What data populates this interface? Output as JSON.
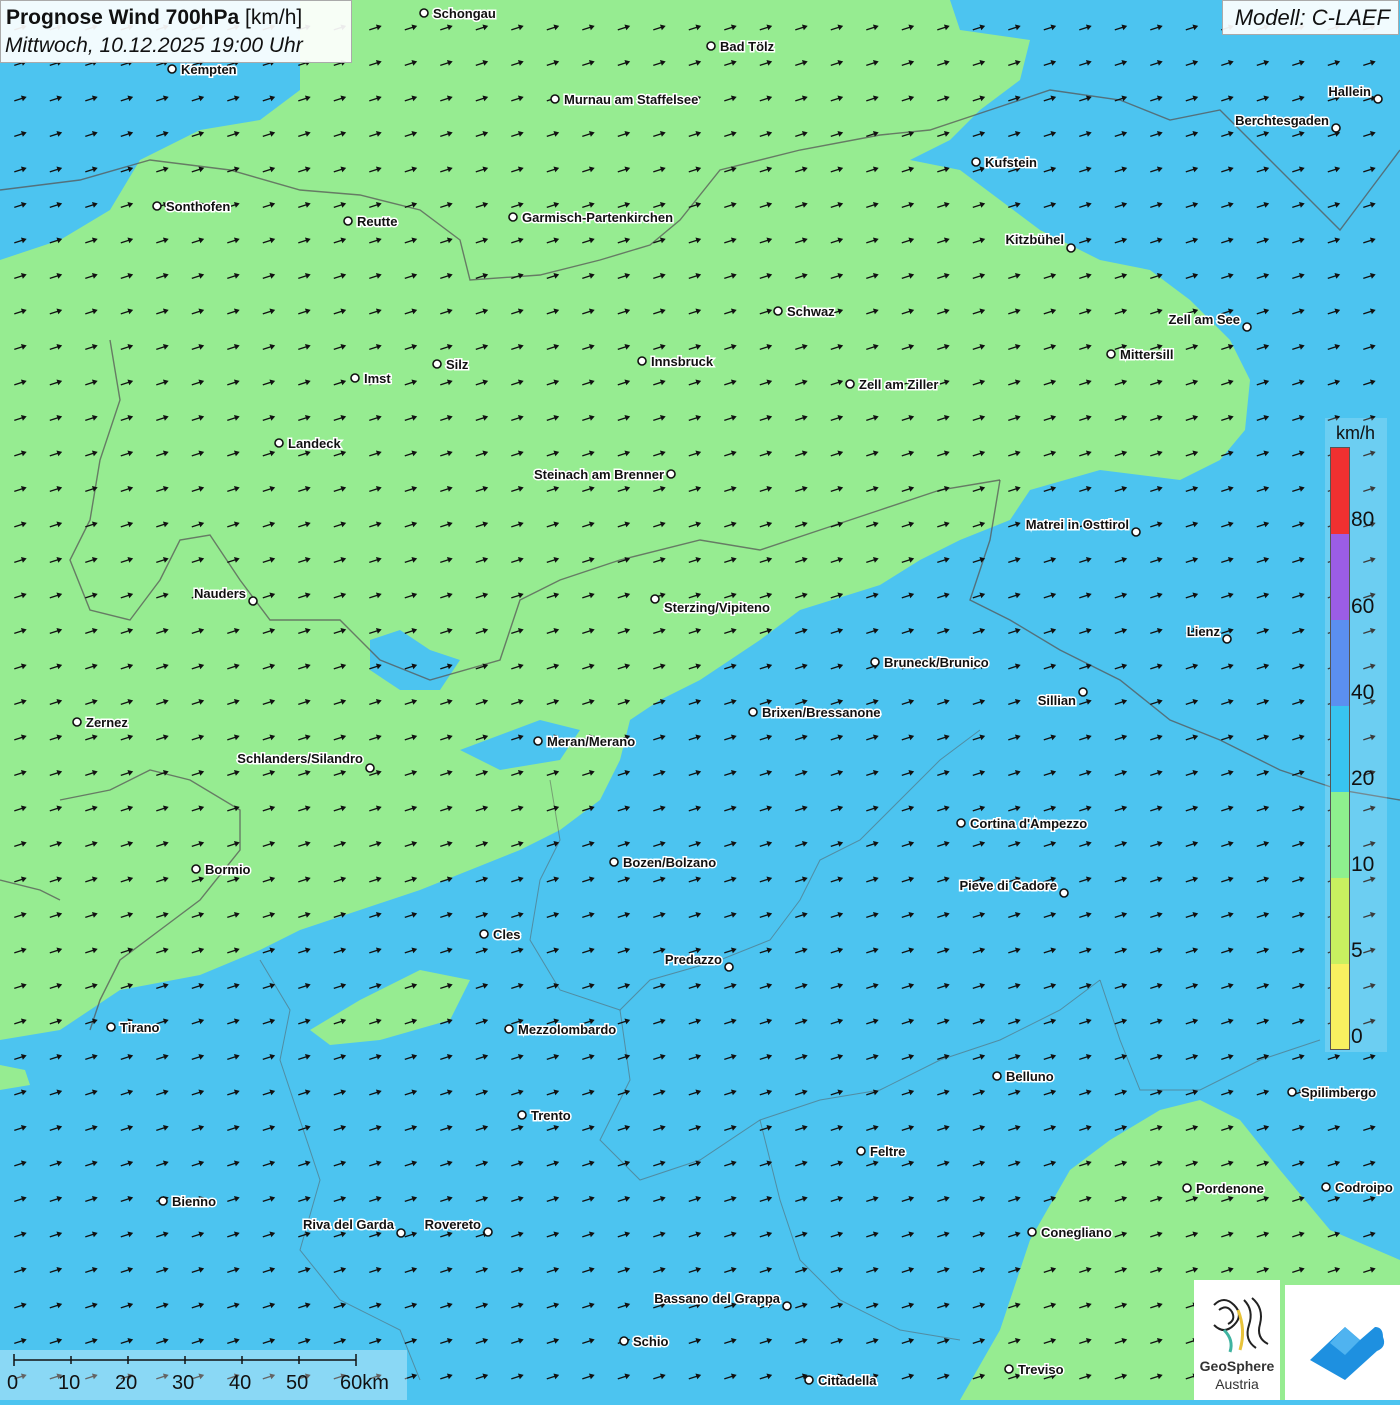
{
  "header": {
    "title_bold": "Prognose Wind 700hPa",
    "title_unit": "[km/h]",
    "datetime": "Mittwoch, 10.12.2025 19:00 Uhr",
    "model": "Modell: C-LAEF"
  },
  "legend": {
    "unit": "km/h",
    "levels": [
      "80",
      "60",
      "40",
      "20",
      "10",
      "5",
      "0"
    ],
    "colors": [
      "#f03030",
      "#9b5de5",
      "#5b8ff0",
      "#38c4f0",
      "#8ef08e",
      "#c8f060",
      "#f8f060"
    ]
  },
  "scale_bar": {
    "labels": [
      "0",
      "10",
      "20",
      "30",
      "40",
      "50",
      "60km"
    ]
  },
  "logo": {
    "name_line1": "GeoSphere",
    "name_line2": "Austria"
  },
  "map": {
    "wind_direction": "from west-southwest",
    "colors": {
      "low_wind": "#96ec91",
      "moderate_wind": "#4cc4f0",
      "border": "#555555",
      "arrow": "#111111"
    },
    "cities": [
      "Schongau",
      "Bad Tölz",
      "Kempten",
      "Murnau am Staffelsee",
      "Hallein",
      "Berchtesgaden",
      "Kufstein",
      "Sonthofen",
      "Reutte",
      "Garmisch-Partenkirchen",
      "Kitzbühel",
      "Schwaz",
      "Zell am See",
      "Mittersill",
      "Innsbruck",
      "Silz",
      "Imst",
      "Zell am Ziller",
      "Landeck",
      "Steinach am Brenner",
      "Matrei in Osttirol",
      "Nauders",
      "Sterzing/Vipiteno",
      "Lienz",
      "Bruneck/Brunico",
      "Sillian",
      "Brixen/Bressanone",
      "Zernez",
      "Meran/Merano",
      "Schlanders/Silandro",
      "Cortina d'Ampezzo",
      "Bozen/Bolzano",
      "Bormio",
      "Pieve di Cadore",
      "Cles",
      "Predazzo",
      "Tirano",
      "Mezzolombardo",
      "Belluno",
      "Spilimbergo",
      "Trento",
      "Feltre",
      "Pordenone",
      "Codroipo",
      "Bienno",
      "Riva del Garda",
      "Rovereto",
      "Conegliano",
      "Bassano del Grappa",
      "Schio",
      "Treviso",
      "Cittadella"
    ]
  }
}
